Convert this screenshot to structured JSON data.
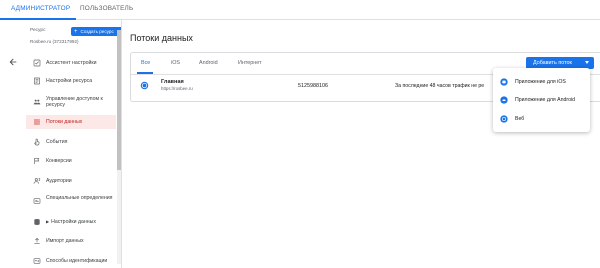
{
  "top_tabs": [
    {
      "label": "АДМИНИСТРАТОР",
      "active": true
    },
    {
      "label": "ПОЛЬЗОВАТЕЛЬ",
      "active": false
    }
  ],
  "left_panel": {
    "resource_label": "Ресурс",
    "create_button": "Создать ресурс",
    "resource_name": "Rosbee.ru (372317992)",
    "nav_items": [
      {
        "label": "Ассистент настройки",
        "icon": "checkbox-icon",
        "active": false
      },
      {
        "label": "Настройки ресурса",
        "icon": "settings-page-icon",
        "active": false
      },
      {
        "label": "Управление доступом к ресурсу",
        "icon": "people-icon",
        "active": false
      },
      {
        "label": "Потоки данных",
        "icon": "data-streams-icon",
        "active": true
      },
      {
        "label": "События",
        "icon": "touch-icon",
        "active": false
      },
      {
        "label": "Конверсии",
        "icon": "flag-icon",
        "active": false
      },
      {
        "label": "Аудитории",
        "icon": "audience-icon",
        "active": false
      },
      {
        "label": "Специальные определения",
        "icon": "custom-definitions-icon",
        "active": false
      },
      {
        "label": "Настройки данных",
        "icon": "database-icon",
        "active": false,
        "expandable": true
      },
      {
        "label": "Импорт данных",
        "icon": "upload-icon",
        "active": false
      },
      {
        "label": "Способы идентификации",
        "icon": "identity-icon",
        "active": false
      }
    ]
  },
  "main": {
    "title": "Потоки данных",
    "tabs": [
      {
        "label": "Все",
        "active": true
      },
      {
        "label": "iOS",
        "active": false
      },
      {
        "label": "Android",
        "active": false
      },
      {
        "label": "Интернет",
        "active": false
      }
    ],
    "add_button": "Добавить поток",
    "stream_row": {
      "name": "Главная",
      "url": "https://rosbee.ru",
      "stream_id": "5125988106",
      "traffic": "За последние 48 часов трафик не ре"
    }
  },
  "add_menu": {
    "items": [
      {
        "label": "Приложение для iOS",
        "icon": "ios-icon"
      },
      {
        "label": "Приложение для Android",
        "icon": "android-icon"
      },
      {
        "label": "Веб",
        "icon": "web-icon"
      }
    ]
  },
  "colors": {
    "accent": "#1a73e8",
    "active_nav_bg": "#fce8e6",
    "active_nav_text": "#c5221f"
  }
}
